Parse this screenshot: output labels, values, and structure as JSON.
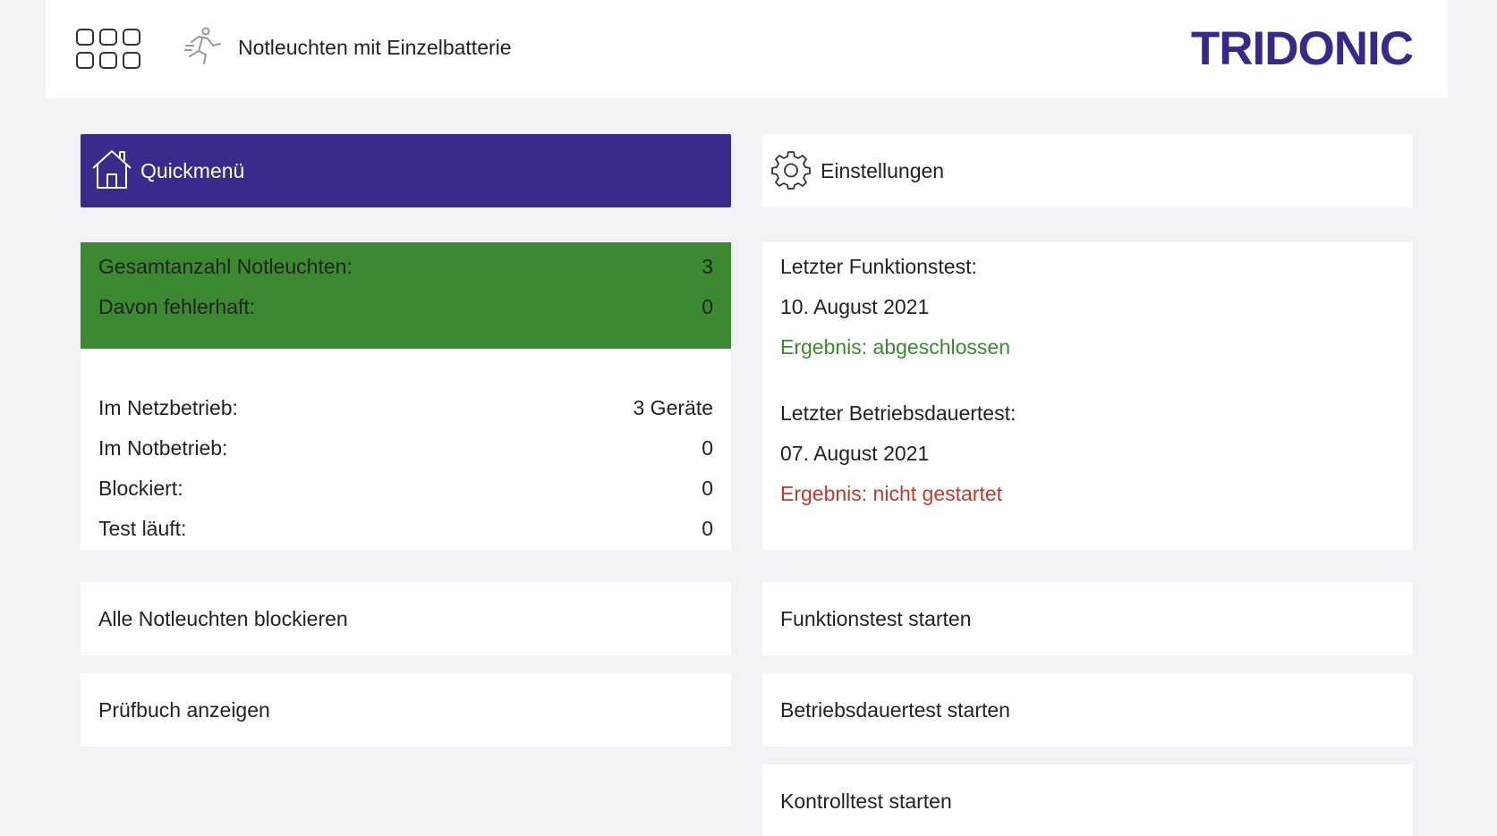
{
  "header": {
    "title": "Notleuchten mit Einzelbatterie",
    "brand": "TRIDONIC"
  },
  "nav": {
    "quick_menu": "Quickmenü",
    "settings": "Einstellungen"
  },
  "status": {
    "summary": [
      {
        "label": "Gesamtanzahl Notleuchten:",
        "value": "3"
      },
      {
        "label": "Davon fehlerhaft:",
        "value": "0"
      }
    ],
    "details": [
      {
        "label": "Im Netzbetrieb:",
        "value": "3 Geräte"
      },
      {
        "label": "Im Notbetrieb:",
        "value": "0"
      },
      {
        "label": "Blockiert:",
        "value": "0"
      },
      {
        "label": "Test läuft:",
        "value": "0"
      }
    ]
  },
  "tests": {
    "function_test": {
      "label": "Letzter Funktionstest:",
      "date": "10. August 2021",
      "result": "Ergebnis: abgeschlossen"
    },
    "duration_test": {
      "label": "Letzter Betriebsdauertest:",
      "date": "07. August 2021",
      "result": "Ergebnis: nicht gestartet"
    }
  },
  "actions": {
    "block_all": "Alle Notleuchten blockieren",
    "show_logbook": "Prüfbuch anzeigen",
    "start_function_test": "Funktionstest starten",
    "start_duration_test": "Betriebsdauertest starten",
    "start_control_test": "Kontrolltest starten"
  },
  "colors": {
    "brand": "#36298a",
    "ok": "#3b8a31",
    "error": "#c0392b",
    "background": "#f3f2f7"
  },
  "icons": [
    "apps-grid-icon",
    "running-person-icon",
    "home-icon",
    "gear-icon"
  ]
}
